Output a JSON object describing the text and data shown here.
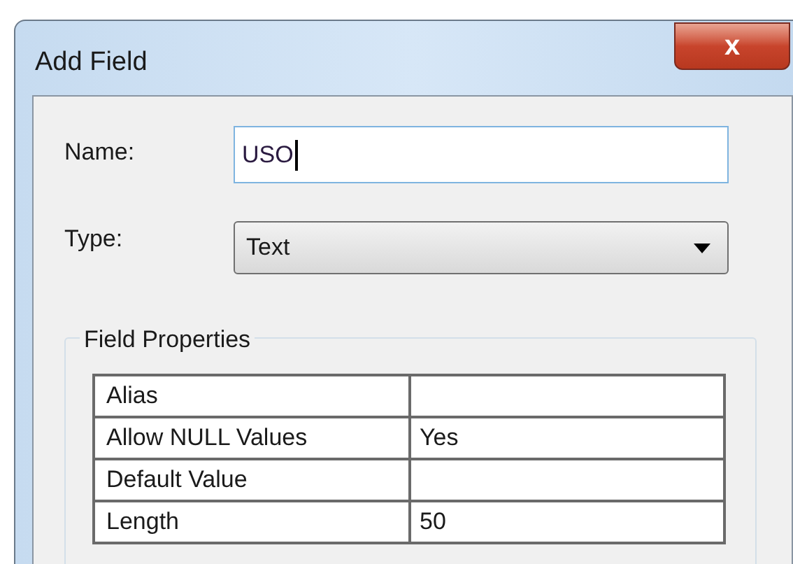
{
  "window": {
    "title": "Add Field",
    "close": "x"
  },
  "name": {
    "label": "Name:",
    "value": "USO"
  },
  "type": {
    "label": "Type:",
    "value": "Text"
  },
  "field_properties": {
    "title": "Field Properties",
    "rows": [
      {
        "property": "Alias",
        "value": ""
      },
      {
        "property": "Allow NULL Values",
        "value": "Yes"
      },
      {
        "property": "Default Value",
        "value": ""
      },
      {
        "property": "Length",
        "value": "50"
      }
    ]
  }
}
